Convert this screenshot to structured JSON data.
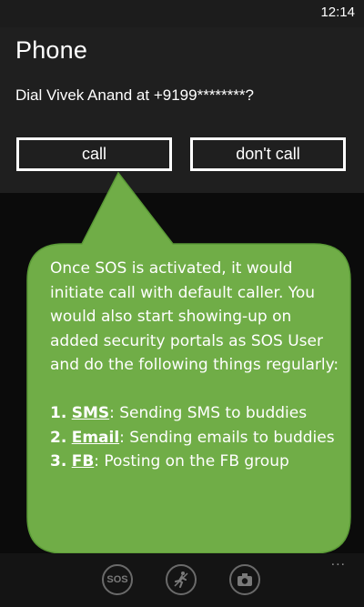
{
  "status_bar": {
    "time": "12:14"
  },
  "dialog": {
    "title": "Phone",
    "prompt": "Dial Vivek Anand at +9199********?",
    "call_label": "call",
    "dont_call_label": "don't call"
  },
  "callout": {
    "intro": "Once SOS is activated, it would initiate call with default caller. You would also start showing-up on added security portals as SOS User and do the following things regularly:",
    "items": [
      {
        "num": "1.",
        "name": "SMS",
        "desc": ": Sending SMS to buddies"
      },
      {
        "num": "2.",
        "name": "Email",
        "desc": ": Sending emails to buddies"
      },
      {
        "num": "3.",
        "name": "FB",
        "desc": ": Posting on the FB group"
      }
    ],
    "color": "#70ad47"
  },
  "app_bar": {
    "icons": [
      "sos-icon",
      "runner-icon",
      "camera-icon"
    ],
    "sos_text": "SOS",
    "more": "..."
  }
}
